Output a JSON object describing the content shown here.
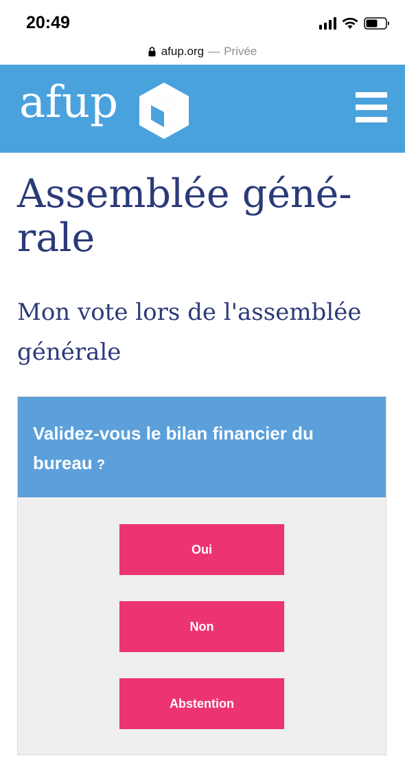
{
  "status_bar": {
    "time": "20:49",
    "icons": [
      "signal-icon",
      "wifi-icon",
      "battery-icon"
    ]
  },
  "address_bar": {
    "url": "afup.org",
    "separator": "—",
    "mode": "Privée"
  },
  "header": {
    "logo_text": "afup",
    "brand_color": "#4aa2dd",
    "menu_icon": "hamburger-menu-icon"
  },
  "main": {
    "title": "Assemblée géné-rale",
    "subtitle": "Mon vote lors de l'assemblée générale"
  },
  "vote": {
    "question": "Validez-vous le bilan financier du bureau",
    "question_mark": "?",
    "header_color": "#5b9fdb",
    "button_color": "#ec3570",
    "options": [
      "Oui",
      "Non",
      "Abstention"
    ]
  }
}
